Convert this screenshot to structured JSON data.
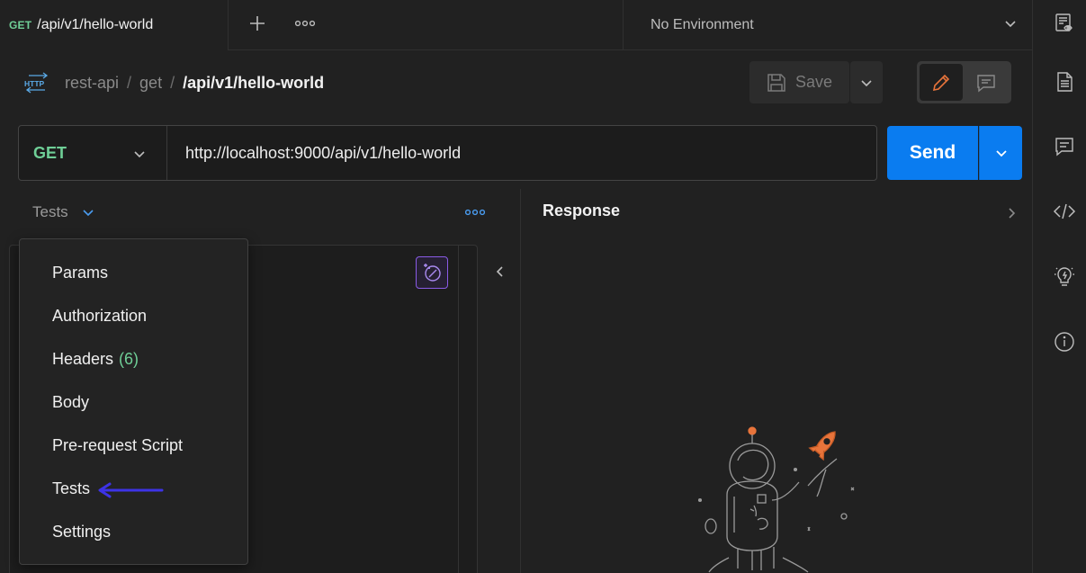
{
  "tabs": {
    "active": {
      "method": "GET",
      "name": "/api/v1/hello-world"
    },
    "new_tab_icon": "plus-icon",
    "more_icon": "more-horizontal-icon"
  },
  "environment": {
    "selected": "No Environment"
  },
  "breadcrumb": {
    "icon": "http-icon",
    "items": [
      "rest-api",
      "get",
      "/api/v1/hello-world"
    ],
    "separator": "/"
  },
  "toolbar": {
    "save_label": "Save"
  },
  "request": {
    "method": "GET",
    "url": "http://localhost:9000/api/v1/hello-world",
    "send_label": "Send"
  },
  "section": {
    "label": "Tests"
  },
  "menu": {
    "items": [
      {
        "label": "Params"
      },
      {
        "label": "Authorization"
      },
      {
        "label": "Headers",
        "count": "(6)"
      },
      {
        "label": "Body"
      },
      {
        "label": "Pre-request Script"
      },
      {
        "label": "Tests"
      },
      {
        "label": "Settings"
      }
    ]
  },
  "response": {
    "title": "Response"
  },
  "colors": {
    "accent": "#0a7cf0",
    "method_get": "#6fcf97",
    "annotation": "#3d33e6",
    "edit_icon": "#e8743b",
    "ai": "#8a5be6"
  }
}
